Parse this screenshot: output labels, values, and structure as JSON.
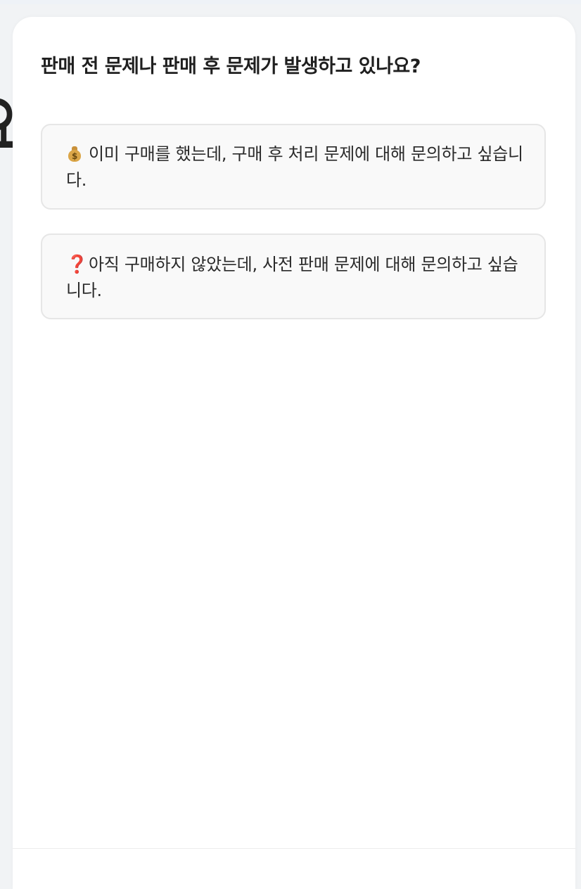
{
  "background": {
    "glyph": "요"
  },
  "dialog": {
    "title": "판매 전 문제나 판매 후 문제가 발생하고 있나요?",
    "options": [
      {
        "icon": "money-bag-icon",
        "label": "이미 구매를 했는데, 구매 후 처리 문제에 대해 문의하고 싶습니다."
      },
      {
        "icon": "question-mark-icon",
        "icon_glyph": "❓",
        "label": "아직 구매하지 않았는데, 사전 판매 문제에 대해 문의하고 싶습니다."
      }
    ]
  },
  "colors": {
    "page_background": "#f1f3f5",
    "sheet_background": "#ffffff",
    "option_background": "#f9f9f9",
    "option_border": "#e6e6e6",
    "title_text": "#1f1f1f",
    "question_mark": "#d7312c"
  }
}
